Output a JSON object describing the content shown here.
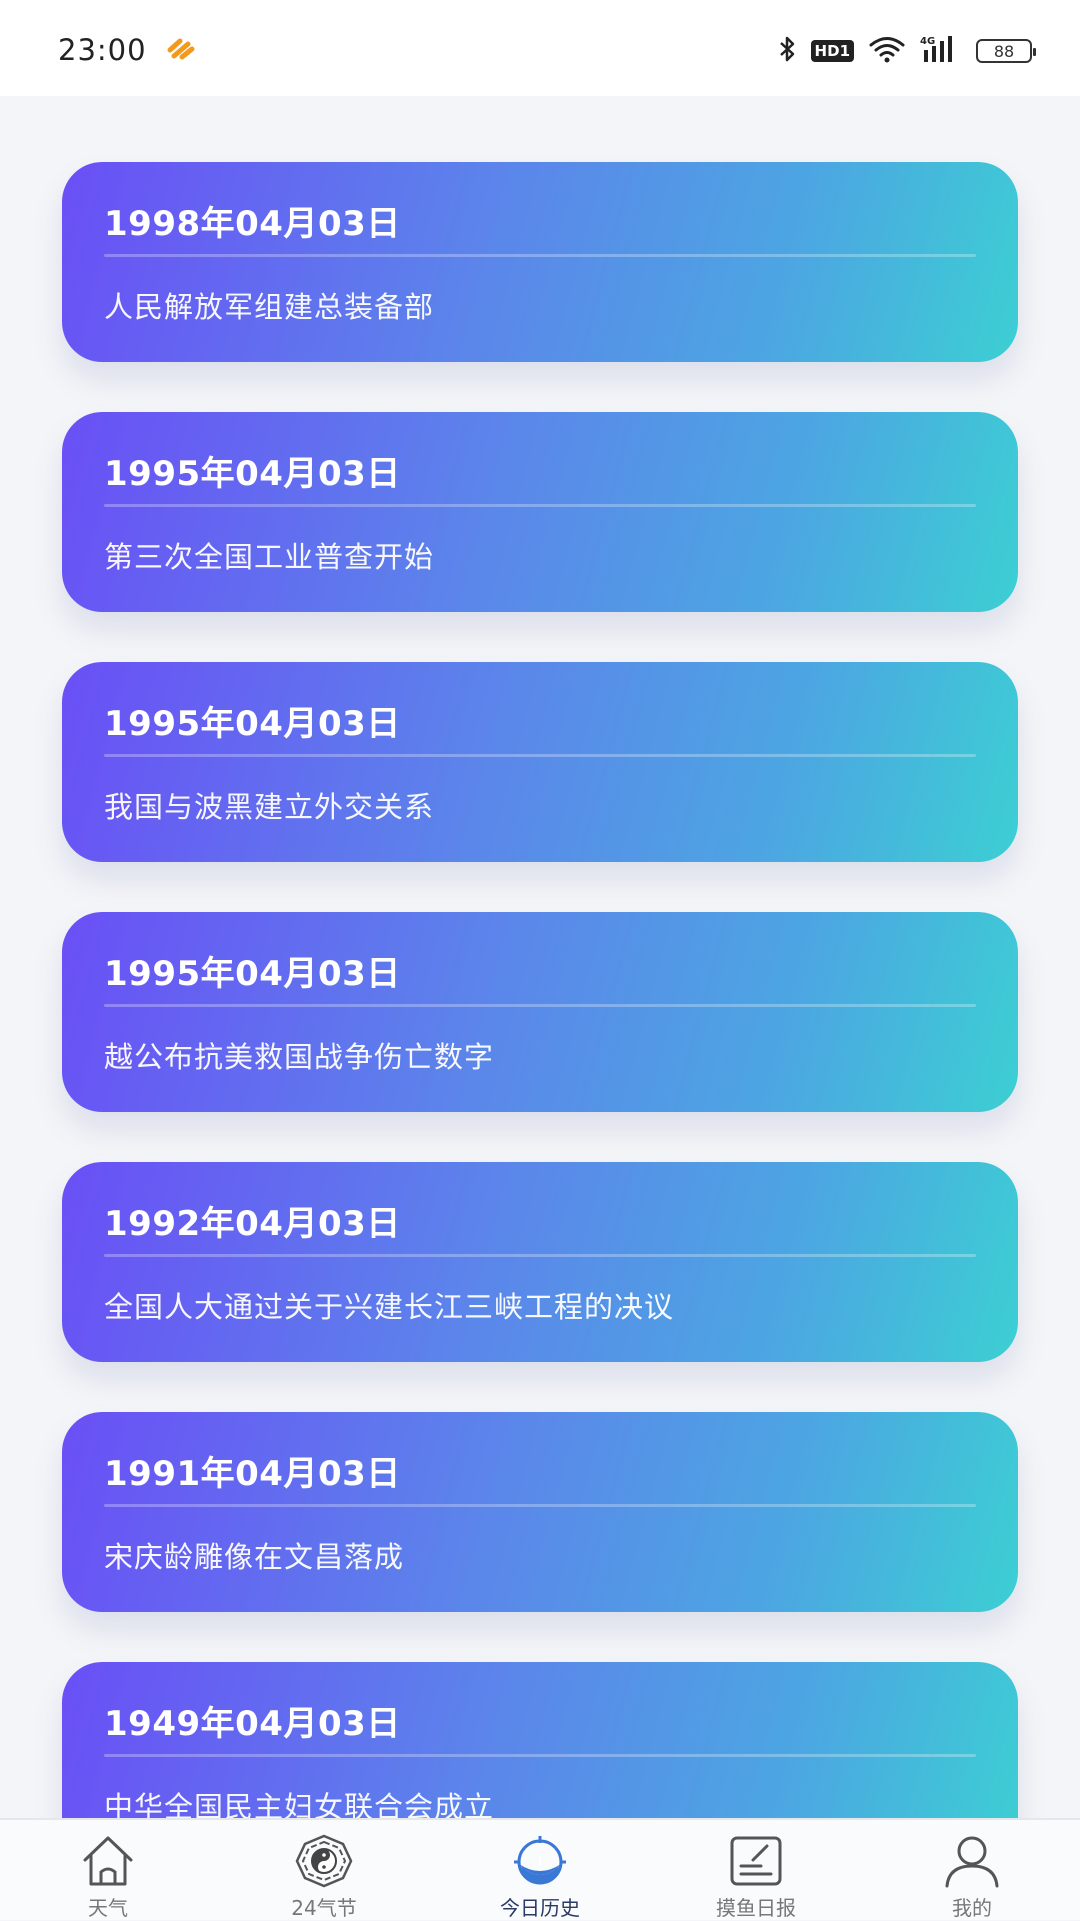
{
  "status_bar": {
    "time": "23:00",
    "battery": "88",
    "network": "4G",
    "hd_label": "HD"
  },
  "events": [
    {
      "date": "1998年04月03日",
      "title": "人民解放军组建总装备部"
    },
    {
      "date": "1995年04月03日",
      "title": "第三次全国工业普查开始"
    },
    {
      "date": "1995年04月03日",
      "title": "我国与波黑建立外交关系"
    },
    {
      "date": "1995年04月03日",
      "title": "越公布抗美救国战争伤亡数字"
    },
    {
      "date": "1992年04月03日",
      "title": "全国人大通过关于兴建长江三峡工程的决议"
    },
    {
      "date": "1991年04月03日",
      "title": "宋庆龄雕像在文昌落成"
    },
    {
      "date": "1949年04月03日",
      "title": "中华全国民主妇女联合会成立"
    }
  ],
  "tabs": [
    {
      "label": "天气",
      "icon": "house-icon"
    },
    {
      "label": "24气节",
      "icon": "bagua-icon"
    },
    {
      "label": "今日历史",
      "icon": "history-globe-icon",
      "active": true
    },
    {
      "label": "摸鱼日报",
      "icon": "notepad-icon"
    },
    {
      "label": "我的",
      "icon": "user-icon"
    }
  ],
  "colors": {
    "card_gradient_start": "#6a4ff6",
    "card_gradient_end": "#3ccfd3",
    "active_tab": "#2a3a66",
    "active_icon": "#3a78d6"
  }
}
